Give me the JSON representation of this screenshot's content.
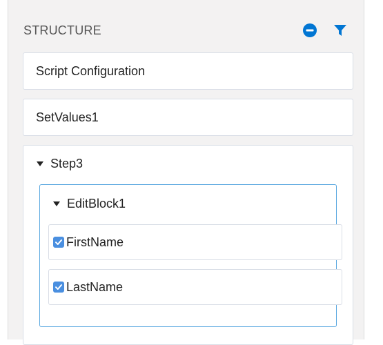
{
  "structure_panel": {
    "title": "STRUCTURE",
    "icons": {
      "collapse": "minus-circle-icon",
      "filter": "filter-icon"
    },
    "colors": {
      "accent": "#0176d3",
      "checkbox": "#4a8fe0",
      "selected_border": "#5aa8e0"
    },
    "items": [
      {
        "label": "Script Configuration"
      },
      {
        "label": "SetValues1"
      },
      {
        "label": "Step3",
        "expanded": true,
        "children": [
          {
            "label": "EditBlock1",
            "expanded": true,
            "selected": true,
            "fields": [
              {
                "label": "FirstName",
                "checked": true
              },
              {
                "label": "LastName",
                "checked": true
              }
            ]
          }
        ]
      }
    ]
  }
}
